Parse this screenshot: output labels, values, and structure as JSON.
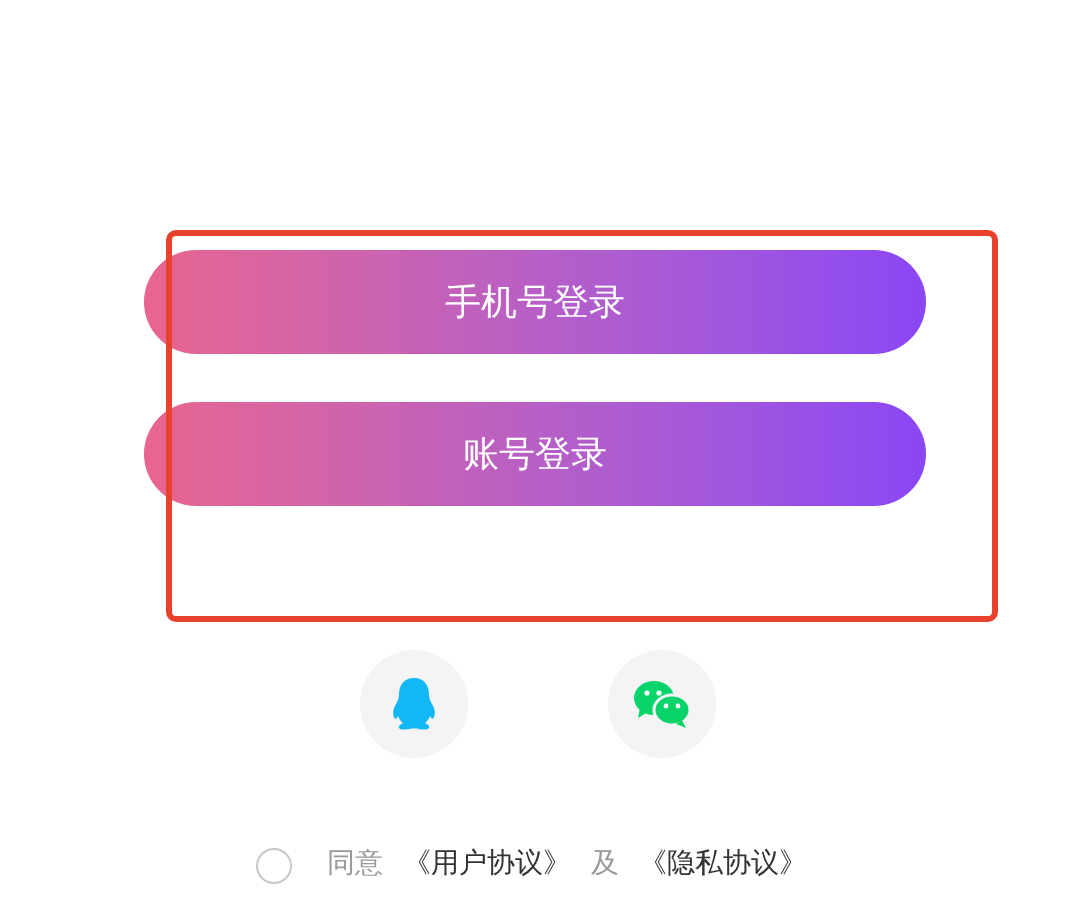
{
  "login_buttons": [
    {
      "label": "手机号登录"
    },
    {
      "label": "账号登录"
    }
  ],
  "social_logins": [
    {
      "kind": "qq"
    },
    {
      "kind": "wechat"
    }
  ],
  "agreement": {
    "checked": false,
    "prefix": "同意",
    "terms_link": "《用户协议》",
    "conjunction": "及",
    "privacy_link": "《隐私协议》"
  }
}
